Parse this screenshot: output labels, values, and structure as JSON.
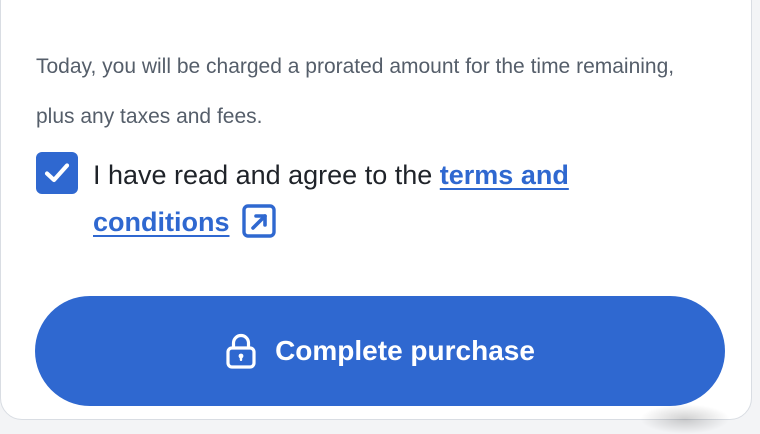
{
  "notice": {
    "text": "Today, you will be charged a prorated amount for the time remaining, plus any taxes and fees."
  },
  "agreement": {
    "checked": true,
    "prefix": "I have read and agree to the",
    "link_label": "terms and conditions"
  },
  "purchase": {
    "label": "Complete purchase"
  },
  "colors": {
    "accent": "#2f68d0",
    "text": "#1f2329",
    "muted_text": "#555e6a",
    "card_border": "#d9dde3"
  },
  "icons": {
    "checkbox": "checkmark-icon",
    "link": "external-link-icon",
    "button": "lock-icon"
  }
}
